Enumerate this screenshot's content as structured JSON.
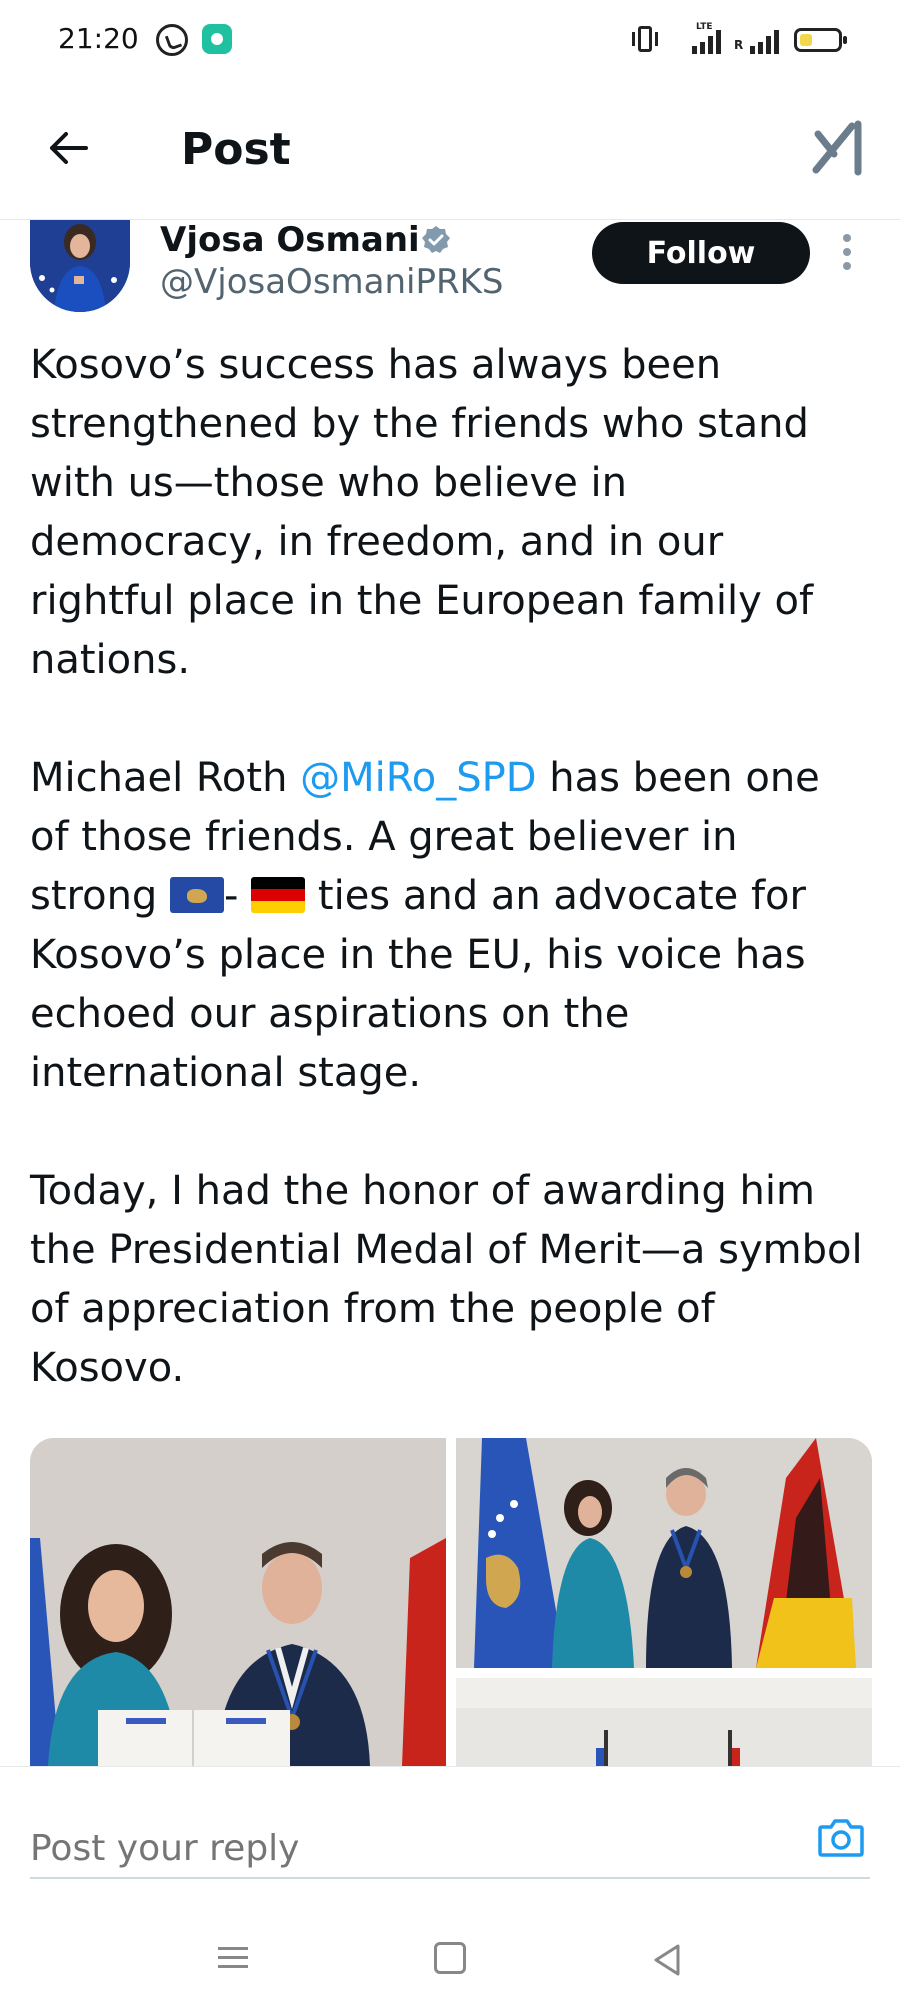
{
  "status_bar": {
    "time": "21:20",
    "icons": [
      "viber-icon",
      "app-notification-icon",
      "vibrate-icon",
      "lte-signal-icon",
      "roaming-signal-icon",
      "battery-icon"
    ],
    "lte_label": "LTE",
    "roaming_label": "R"
  },
  "header": {
    "title": "Post",
    "back_icon": "arrow-left-icon",
    "logo": "x-logo"
  },
  "author": {
    "name": "Vjosa Osmani",
    "handle": "@VjosaOsmaniPRKS",
    "verified": true,
    "follow_label": "Follow"
  },
  "post": {
    "paragraph_1": "Kosovo’s success has always been strengthened by the friends who stand with us—those who believe in democracy, in freedom, and in our rightful place in the European family of nations.",
    "paragraph_2_before_mention": "Michael Roth ",
    "mention": "@MiRo_SPD",
    "paragraph_2_after_mention": " has been one of those friends. A great believer in strong ",
    "flag_separator": "- ",
    "paragraph_2_after_flags": " ties and an advocate for Kosovo’s place in the EU, his voice has echoed our aspirations on the international stage.",
    "paragraph_3": "Today, I had the honor of awarding him the Presidential Medal of Merit—a symbol of appreciation from the people of Kosovo.",
    "flags": [
      "kosovo-flag",
      "germany-flag"
    ]
  },
  "media": {
    "count_visible": 3
  },
  "reply": {
    "placeholder": "Post your reply",
    "camera_icon": "camera-icon"
  },
  "nav_bar": {
    "icons": [
      "menu-icon",
      "home-icon",
      "back-triangle-icon"
    ]
  },
  "colors": {
    "accent": "#1d9bf0",
    "text_primary": "#0f1419",
    "text_secondary": "#536471",
    "follow_bg": "#0f1419"
  }
}
